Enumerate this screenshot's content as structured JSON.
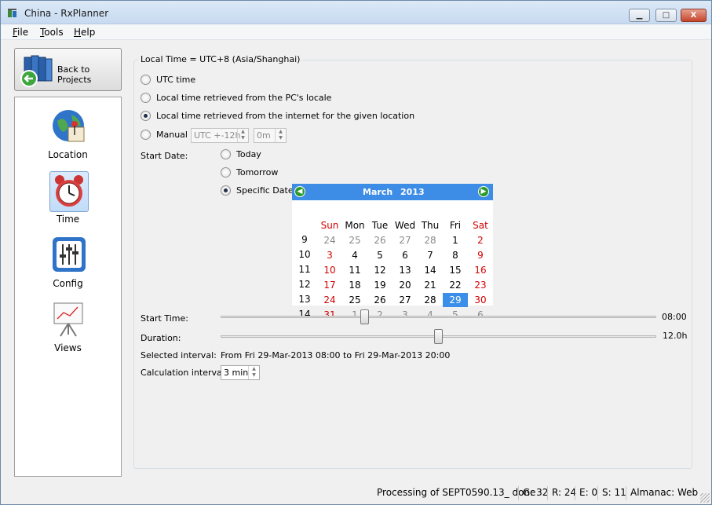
{
  "window": {
    "title": "China - RxPlanner",
    "min_glyph": "▁",
    "max_glyph": "□",
    "close_glyph": "X"
  },
  "menu": {
    "file": "File",
    "tools": "Tools",
    "help": "Help"
  },
  "back_button": {
    "label": "Back to Projects",
    "icon": "back-arrow-books-icon"
  },
  "sidebar": {
    "items": [
      {
        "label": "Location",
        "icon": "globe-pin-icon",
        "selected": false
      },
      {
        "label": "Time",
        "icon": "alarm-clock-icon",
        "selected": true
      },
      {
        "label": "Config",
        "icon": "sliders-icon",
        "selected": false
      },
      {
        "label": "Views",
        "icon": "chart-easel-icon",
        "selected": false
      }
    ]
  },
  "time_panel": {
    "group_title": "Local Time = UTC+8  (Asia/Shanghai)",
    "options": [
      {
        "label": "UTC time",
        "checked": false
      },
      {
        "label": "Local time retrieved from the PC's locale",
        "checked": false
      },
      {
        "label": "Local time retrieved from the internet for the given location",
        "checked": true
      },
      {
        "label": "Manual",
        "checked": false
      }
    ],
    "manual_hours": "UTC +-12h",
    "manual_minutes": "0m",
    "start_date_label": "Start Date:",
    "date_options": [
      {
        "label": "Today",
        "checked": false
      },
      {
        "label": "Tomorrow",
        "checked": false
      },
      {
        "label": "Specific Date",
        "checked": true
      }
    ],
    "calendar": {
      "month": "March",
      "year": "2013",
      "prev_glyph": "◀",
      "next_glyph": "▶",
      "dow": [
        "Sun",
        "Mon",
        "Tue",
        "Wed",
        "Thu",
        "Fri",
        "Sat"
      ],
      "weeks": [
        "9",
        "10",
        "11",
        "12",
        "13",
        "14"
      ],
      "days": [
        [
          "24",
          "25",
          "26",
          "27",
          "28",
          "1",
          "2"
        ],
        [
          "3",
          "4",
          "5",
          "6",
          "7",
          "8",
          "9"
        ],
        [
          "10",
          "11",
          "12",
          "13",
          "14",
          "15",
          "16"
        ],
        [
          "17",
          "18",
          "19",
          "20",
          "21",
          "22",
          "23"
        ],
        [
          "24",
          "25",
          "26",
          "27",
          "28",
          "29",
          "30"
        ],
        [
          "31",
          "1",
          "2",
          "3",
          "4",
          "5",
          "6"
        ]
      ],
      "other_month_rows": {
        "0": [
          0,
          1,
          2,
          3,
          4
        ],
        "5": [
          1,
          2,
          3,
          4,
          5,
          6
        ]
      },
      "selected_day": "29",
      "weekend_color": "#d40000",
      "accent": "#3d8ce6"
    },
    "start_time_label": "Start Time:",
    "start_time_value": "08:00",
    "start_time_fraction": 0.33,
    "duration_label": "Duration:",
    "duration_value": "12.0h",
    "duration_fraction": 0.5,
    "selected_interval_label": "Selected interval:",
    "selected_interval_value": "From Fri 29-Mar-2013 08:00 to Fri 29-Mar-2013 20:00",
    "calc_interval_label": "Calculation interval:",
    "calc_interval_value": "3 min"
  },
  "status": {
    "message": "Processing of SEPT0590.13_ done",
    "g": "G: 32",
    "r": "R: 24",
    "e": "E: 0",
    "s": "S: 11",
    "almanac": "Almanac: Web"
  }
}
